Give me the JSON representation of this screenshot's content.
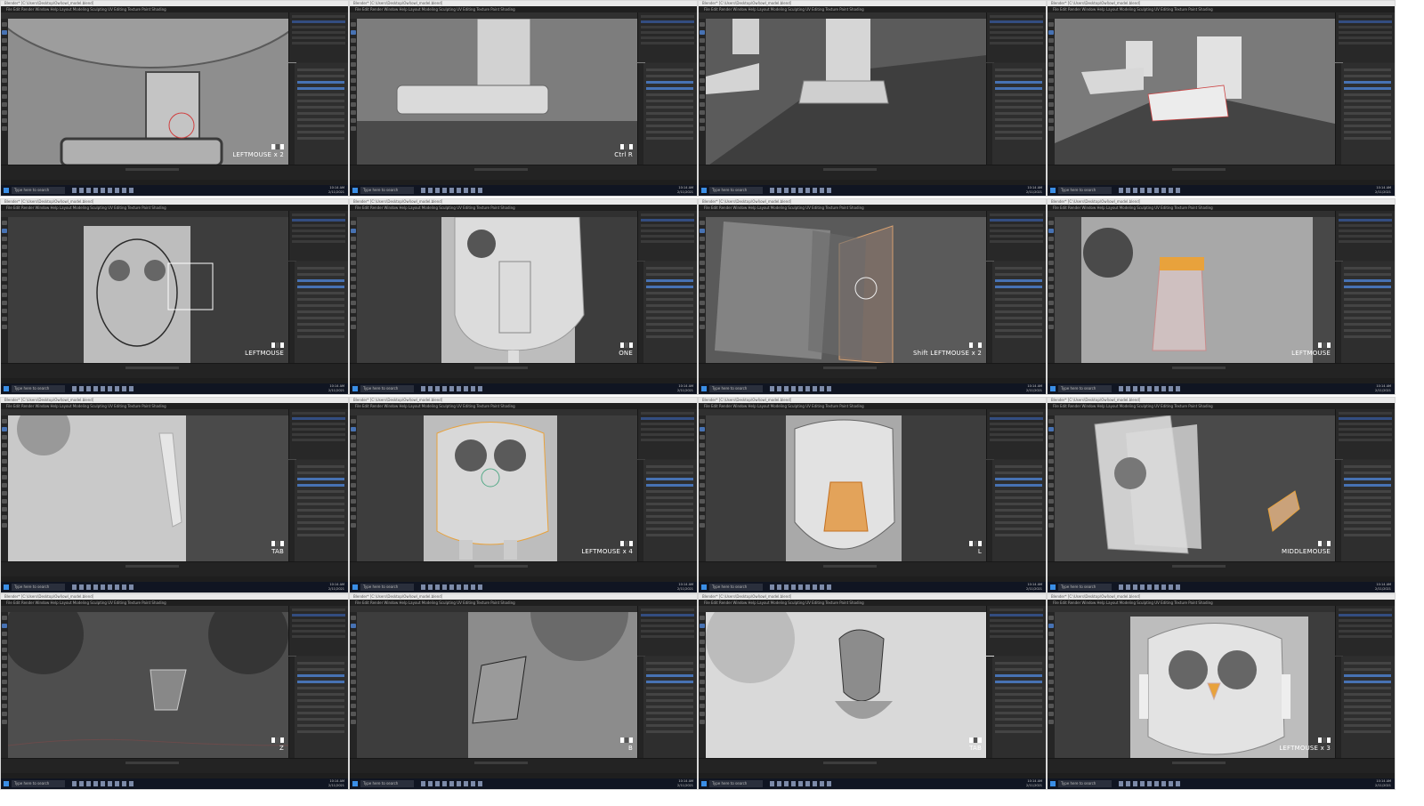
{
  "app": {
    "window_title": "Blender* [C:\\Users\\Desktop\\Owl\\owl_model.blend]",
    "menu": "File  Edit  Render  Window  Help   Layout  Modeling  Sculpting  UV Editing  Texture Paint  Shading",
    "taskbar_search": "Type here to search",
    "clock_time": "10:14 AM",
    "clock_date": "2/11/2021"
  },
  "frames": [
    {
      "key": "LEFTMOUSE x 2"
    },
    {
      "key": "Ctrl R"
    },
    {
      "key": ""
    },
    {
      "key": ""
    },
    {
      "key": "LEFTMOUSE"
    },
    {
      "key": "ONE"
    },
    {
      "key": "Shift LEFTMOUSE x 2"
    },
    {
      "key": "LEFTMOUSE"
    },
    {
      "key": "TAB"
    },
    {
      "key": "LEFTMOUSE x 4"
    },
    {
      "key": "L"
    },
    {
      "key": "MIDDLEMOUSE"
    },
    {
      "key": "Z"
    },
    {
      "key": "B"
    },
    {
      "key": "TAB"
    },
    {
      "key": "LEFTMOUSE x 3"
    }
  ],
  "colors": {
    "viewport_bg": "#3d3d3d",
    "panel_bg": "#2e2e2e",
    "selection_blue": "#4772b3",
    "selection_orange": "#e8a23c",
    "taskbar": "#101522"
  }
}
